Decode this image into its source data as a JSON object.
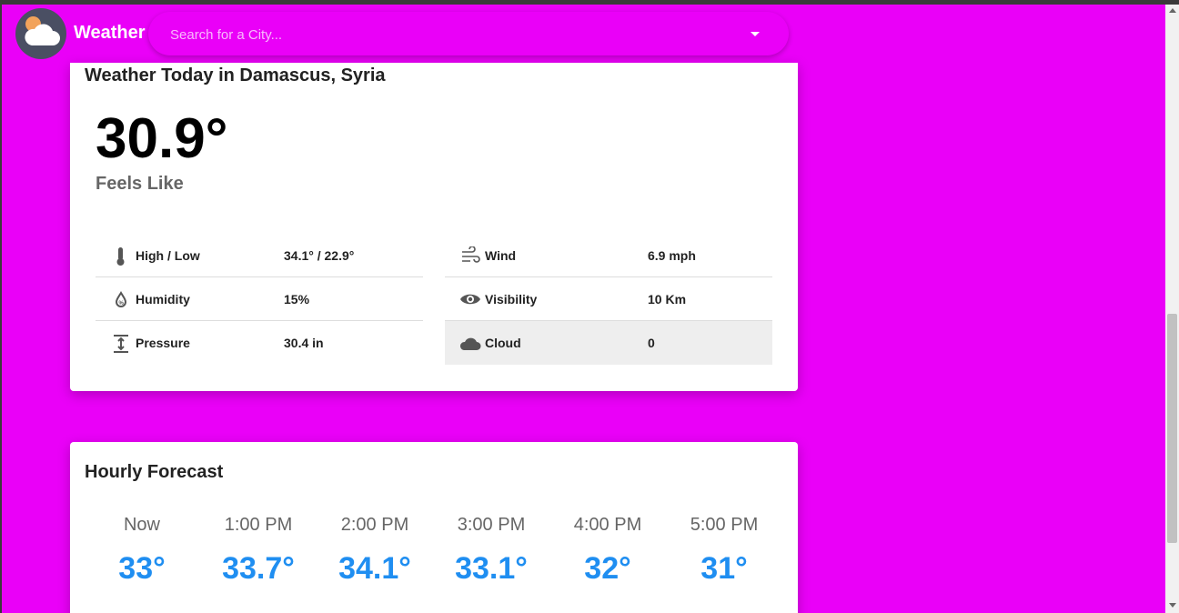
{
  "header": {
    "brand": "Weather",
    "search_placeholder": "Search for a City..."
  },
  "today": {
    "title": "Weather Today in Damascus, Syria",
    "temperature": "30.9°",
    "feels_like_label": "Feels Like",
    "left_rows": [
      {
        "label": "High / Low",
        "value": "34.1° / 22.9°",
        "icon": "thermometer-icon"
      },
      {
        "label": "Humidity",
        "value": "15%",
        "icon": "humidity-icon"
      },
      {
        "label": "Pressure",
        "value": "30.4 in",
        "icon": "pressure-icon"
      }
    ],
    "right_rows": [
      {
        "label": "Wind",
        "value": "6.9 mph",
        "icon": "wind-icon"
      },
      {
        "label": "Visibility",
        "value": "10 Km",
        "icon": "eye-icon"
      },
      {
        "label": "Cloud",
        "value": "0",
        "icon": "cloud-icon"
      }
    ]
  },
  "hourly": {
    "title": "Hourly Forecast",
    "items": [
      {
        "time": "Now",
        "temp": "33°"
      },
      {
        "time": "1:00 PM",
        "temp": "33.7°"
      },
      {
        "time": "2:00 PM",
        "temp": "34.1°"
      },
      {
        "time": "3:00 PM",
        "temp": "33.1°"
      },
      {
        "time": "4:00 PM",
        "temp": "32°"
      },
      {
        "time": "5:00 PM",
        "temp": "31°"
      }
    ]
  },
  "colors": {
    "background": "#ea00f8",
    "accent": "#1f8ef1"
  }
}
